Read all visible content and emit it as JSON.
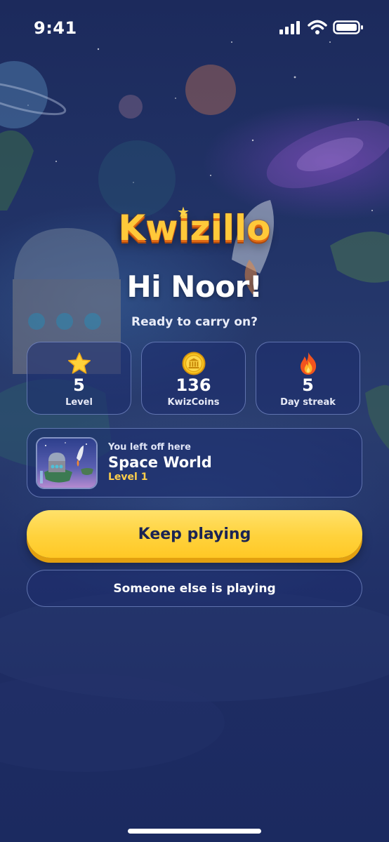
{
  "status_bar": {
    "time": "9:41"
  },
  "logo": {
    "text": "Kwizillo"
  },
  "greeting": {
    "title": "Hi Noor!",
    "subtitle": "Ready to carry on?"
  },
  "stats": [
    {
      "value": "5",
      "label": "Level",
      "icon": "star-icon"
    },
    {
      "value": "136",
      "label": "KwizCoins",
      "icon": "coin-icon"
    },
    {
      "value": "5",
      "label": "Day streak",
      "icon": "flame-icon"
    }
  ],
  "continue_card": {
    "hint": "You left off here",
    "world": "Space World",
    "level": "Level 1"
  },
  "actions": {
    "primary": "Keep playing",
    "secondary": "Someone else is playing"
  },
  "colors": {
    "accent": "#ffd23c",
    "level_text": "#ffcf4a",
    "button_text": "#1b2453"
  }
}
